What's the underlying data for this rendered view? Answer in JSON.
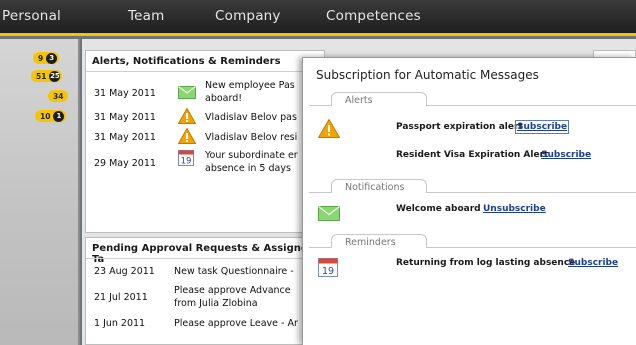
{
  "nav": {
    "personal": "Personal",
    "team": "Team",
    "company": "Company",
    "competences": "Competences"
  },
  "sidebar": {
    "counters": [
      {
        "yellow": "9",
        "dark": "3"
      },
      {
        "yellow": "51",
        "dark": "25"
      },
      {
        "yellow": "34",
        "dark": ""
      },
      {
        "yellow": "10",
        "dark": "1"
      }
    ]
  },
  "alerts_panel": {
    "title": "Alerts, Notifications & Reminders",
    "rows": [
      {
        "date": "31 May 2011",
        "icon": "envelope-icon",
        "text": "New employee Pas",
        "text2": "aboard!"
      },
      {
        "date": "31 May 2011",
        "icon": "warning-icon",
        "text": "Vladislav Belov pas"
      },
      {
        "date": "31 May 2011",
        "icon": "warning-icon",
        "text": "Vladislav Belov resi"
      },
      {
        "date": "29 May 2011",
        "icon": "calendar-icon",
        "text": "Your subordinate er",
        "text2": "absence in 5 days"
      }
    ]
  },
  "pending_panel": {
    "title": "Pending Approval Requests & Assigned Ta",
    "rows": [
      {
        "date": "23 Aug 2011",
        "text": "New task Questionnaire -"
      },
      {
        "date": "21 Jul 2011",
        "text": "Please approve Advance",
        "text2": "from Julia Zlobina"
      },
      {
        "date": "1 Jun 2011",
        "text": "Please approve Leave - Ar"
      }
    ]
  },
  "dialog": {
    "title": "Subscription for Automatic Messages",
    "sections": {
      "alerts": "Alerts",
      "notifications": "Notifications",
      "reminders": "Reminders"
    },
    "items": {
      "passport": {
        "label": "Passport expiration alert",
        "action": "Subscribe"
      },
      "visa": {
        "label": "Resident Visa Expiration Alert",
        "action": "Subscribe"
      },
      "welcome": {
        "label": "Welcome aboard",
        "action": "Unsubscribe"
      },
      "returning": {
        "label": "Returning from log lasting absence",
        "action": "Subscribe"
      }
    },
    "calendar_day": "19"
  },
  "colors": {
    "accent_yellow": "#f5c400",
    "link_blue": "#1c3f94",
    "warning_orange": "#f0a000",
    "envelope_green": "#7fd36a"
  }
}
